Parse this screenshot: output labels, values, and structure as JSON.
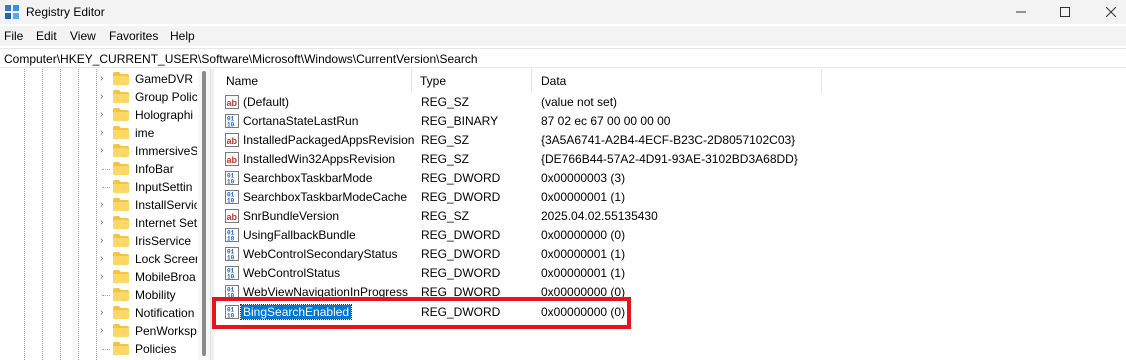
{
  "window": {
    "title": "Registry Editor",
    "controls": {
      "minimize": "–",
      "maximize": "☐",
      "close": "✕"
    }
  },
  "menu": [
    "File",
    "Edit",
    "View",
    "Favorites",
    "Help"
  ],
  "address": "Computer\\HKEY_CURRENT_USER\\Software\\Microsoft\\Windows\\CurrentVersion\\Search",
  "tree": {
    "items": [
      {
        "label": "GameDVR",
        "expandable": true
      },
      {
        "label": "Group Polic",
        "expandable": true
      },
      {
        "label": "Holographi",
        "expandable": true
      },
      {
        "label": "ime",
        "expandable": true
      },
      {
        "label": "ImmersiveS",
        "expandable": true
      },
      {
        "label": "InfoBar",
        "expandable": false
      },
      {
        "label": "InputSettin",
        "expandable": false
      },
      {
        "label": "InstallServic",
        "expandable": true
      },
      {
        "label": "Internet Set",
        "expandable": true
      },
      {
        "label": "IrisService",
        "expandable": true
      },
      {
        "label": "Lock Screen",
        "expandable": true
      },
      {
        "label": "MobileBroa",
        "expandable": true
      },
      {
        "label": "Mobility",
        "expandable": false
      },
      {
        "label": "Notification",
        "expandable": true
      },
      {
        "label": "PenWorksp",
        "expandable": true
      },
      {
        "label": "Policies",
        "expandable": false
      }
    ]
  },
  "list": {
    "columns": {
      "name": "Name",
      "type": "Type",
      "data": "Data"
    },
    "rows": [
      {
        "name": "(Default)",
        "type": "REG_SZ",
        "data": "(value not set)",
        "icon": "string-value-icon"
      },
      {
        "name": "CortanaStateLastRun",
        "type": "REG_BINARY",
        "data": "87 02 ec 67 00 00 00 00",
        "icon": "binary-value-icon"
      },
      {
        "name": "InstalledPackagedAppsRevision",
        "type": "REG_SZ",
        "data": "{3A5A6741-A2B4-4ECF-B23C-2D8057102C03}",
        "icon": "string-value-icon"
      },
      {
        "name": "InstalledWin32AppsRevision",
        "type": "REG_SZ",
        "data": "{DE766B44-57A2-4D91-93AE-3102BD3A68DD}",
        "icon": "string-value-icon"
      },
      {
        "name": "SearchboxTaskbarMode",
        "type": "REG_DWORD",
        "data": "0x00000003 (3)",
        "icon": "binary-value-icon"
      },
      {
        "name": "SearchboxTaskbarModeCache",
        "type": "REG_DWORD",
        "data": "0x00000001 (1)",
        "icon": "binary-value-icon"
      },
      {
        "name": "SnrBundleVersion",
        "type": "REG_SZ",
        "data": "2025.04.02.55135430",
        "icon": "string-value-icon"
      },
      {
        "name": "UsingFallbackBundle",
        "type": "REG_DWORD",
        "data": "0x00000000 (0)",
        "icon": "binary-value-icon"
      },
      {
        "name": "WebControlSecondaryStatus",
        "type": "REG_DWORD",
        "data": "0x00000001 (1)",
        "icon": "binary-value-icon"
      },
      {
        "name": "WebControlStatus",
        "type": "REG_DWORD",
        "data": "0x00000001 (1)",
        "icon": "binary-value-icon"
      },
      {
        "name": "WebViewNavigationInProgress",
        "type": "REG_DWORD",
        "data": "0x00000000 (0)",
        "icon": "binary-value-icon"
      },
      {
        "name": "BingSearchEnabled",
        "type": "REG_DWORD",
        "data": "0x00000000 (0)",
        "icon": "binary-value-icon",
        "selected": true
      }
    ]
  },
  "colors": {
    "selection": "#0078d4",
    "highlight_box": "#e8131b",
    "folder": "#f5c542"
  }
}
